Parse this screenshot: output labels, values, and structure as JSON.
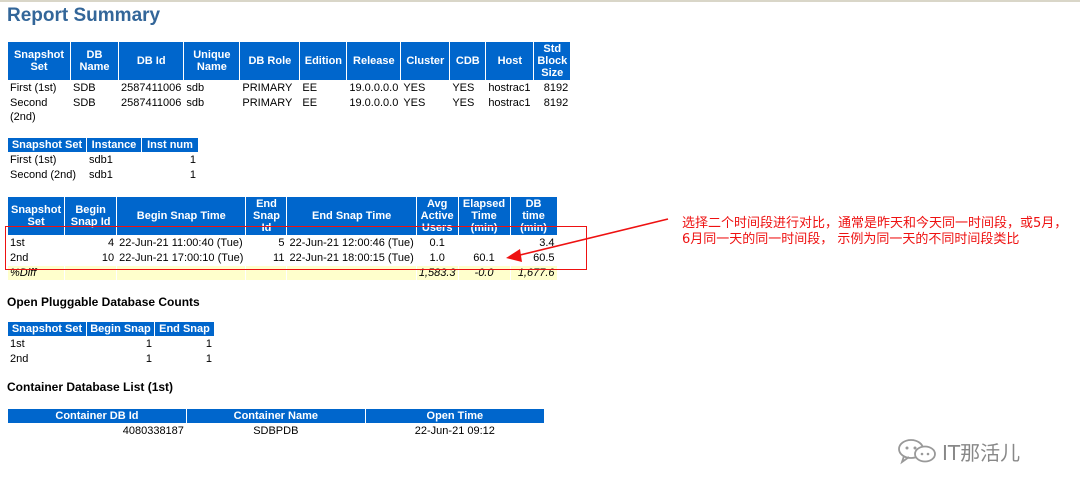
{
  "report": {
    "title": "Report Summary"
  },
  "snapshot_table": {
    "headers": [
      "Snapshot Set",
      "DB Name",
      "DB Id",
      "Unique Name",
      "DB Role",
      "Edition",
      "Release",
      "Cluster",
      "CDB",
      "Host",
      "Std Block Size"
    ],
    "rows": [
      [
        "First (1st)",
        "SDB",
        "2587411006",
        "sdb",
        "PRIMARY",
        "EE",
        "19.0.0.0.0",
        "YES",
        "YES",
        "hostrac1",
        "8192"
      ],
      [
        "Second (2nd)",
        "SDB",
        "2587411006",
        "sdb",
        "PRIMARY",
        "EE",
        "19.0.0.0.0",
        "YES",
        "YES",
        "hostrac1",
        "8192"
      ]
    ]
  },
  "instance_table": {
    "headers": [
      "Snapshot Set",
      "Instance",
      "Inst num"
    ],
    "rows": [
      [
        "First (1st)",
        "sdb1",
        "1"
      ],
      [
        "Second (2nd)",
        "sdb1",
        "1"
      ]
    ]
  },
  "snap_table": {
    "headers": [
      "Snapshot Set",
      "Begin Snap Id",
      "Begin Snap Time",
      "End Snap Id",
      "End Snap Time",
      "Avg Active Users",
      "Elapsed Time (min)",
      "DB time (min)"
    ],
    "rows": [
      [
        "1st",
        "4",
        "22-Jun-21 11:00:40 (Tue)",
        "5",
        "22-Jun-21 12:00:46 (Tue)",
        "0.1",
        "",
        "3.4"
      ],
      [
        "2nd",
        "10",
        "22-Jun-21 17:00:10 (Tue)",
        "11",
        "22-Jun-21 18:00:15 (Tue)",
        "1.0",
        "60.1",
        "60.5"
      ]
    ],
    "diff": [
      "%Diff",
      "",
      "",
      "",
      "",
      "1,583.3",
      "-0.0",
      "1,677.6"
    ]
  },
  "pdb_counts": {
    "title": "Open Pluggable Database Counts",
    "headers": [
      "Snapshot Set",
      "Begin Snap",
      "End Snap"
    ],
    "rows": [
      [
        "1st",
        "1",
        "1"
      ],
      [
        "2nd",
        "1",
        "1"
      ]
    ]
  },
  "cdb_list": {
    "title": "Container Database List (1st)",
    "headers": [
      "Container DB Id",
      "Container Name",
      "Open Time"
    ],
    "rows": [
      [
        "4080338187",
        "SDBPDB",
        "22-Jun-21 09:12"
      ]
    ]
  },
  "annotation": {
    "text": "选择二个时间段进行对比，通常是昨天和今天同一时间段，或5月，6月同一天的同一时间段， 示例为同一天的不同时间段类比"
  },
  "watermark": {
    "text": "IT那活儿",
    "icon": "chat-bubbles-icon"
  },
  "colors": {
    "header_bg": "#0066cc",
    "title": "#336699",
    "annotation": "#ee1111",
    "diff_row": "#ffffcc"
  }
}
